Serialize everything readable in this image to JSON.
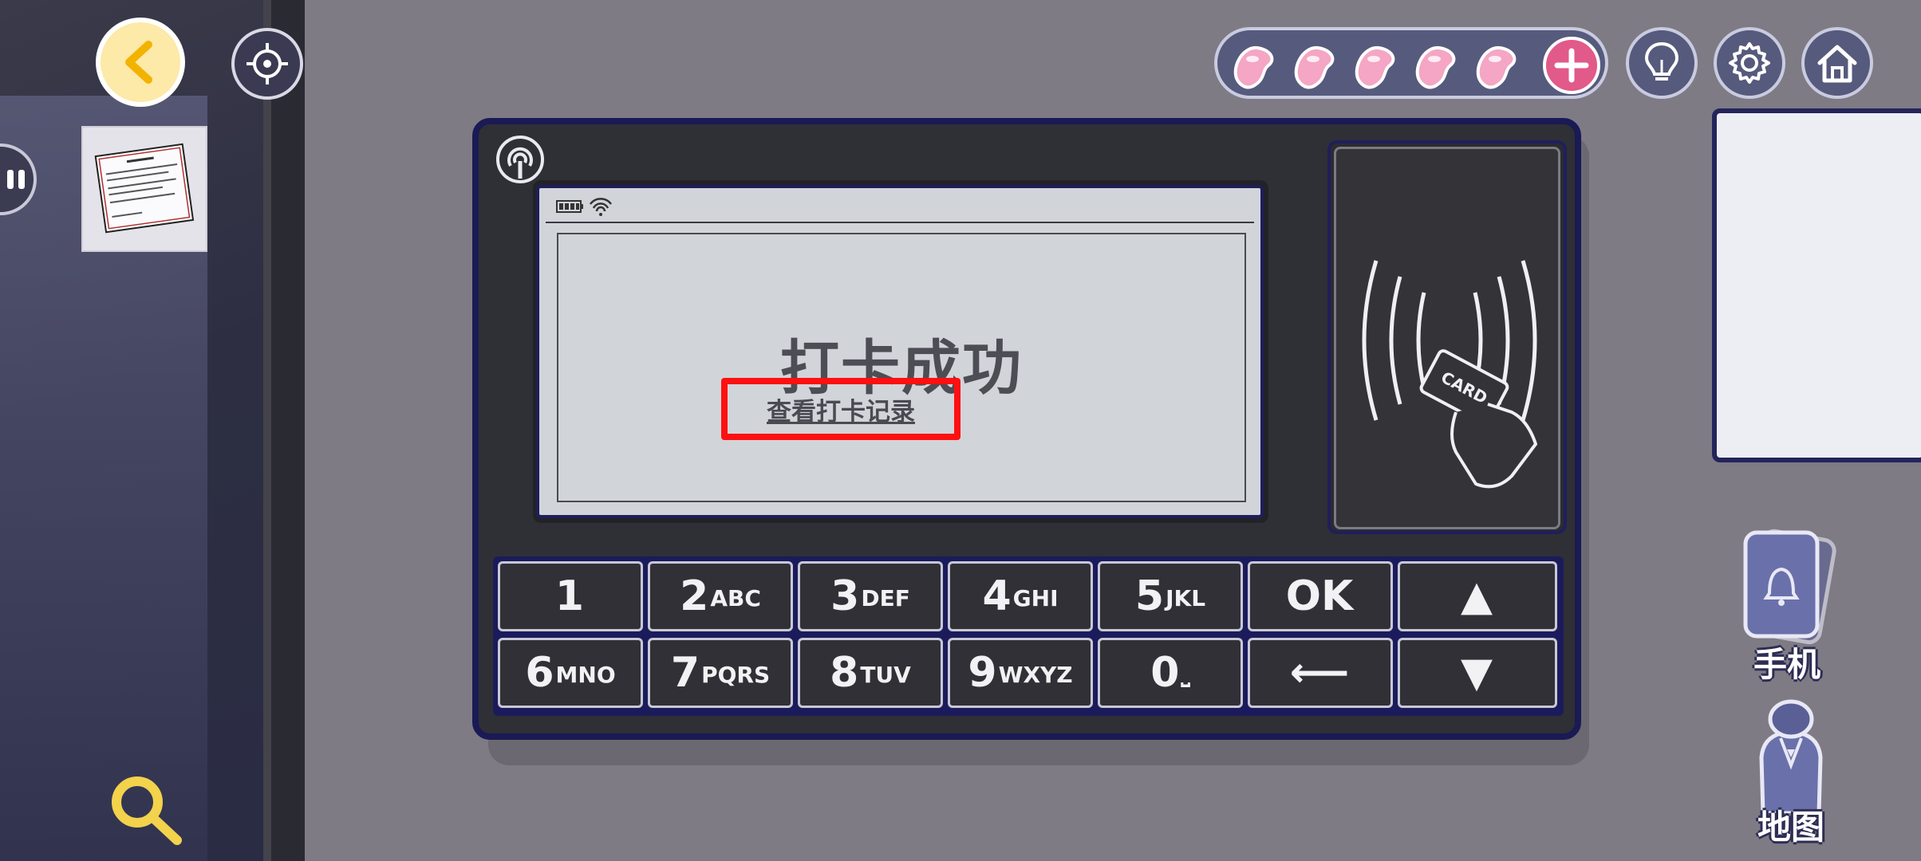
{
  "hud": {
    "energy_count": 5,
    "energy_icon": "pink-bean-icon",
    "add_icon": "plus-icon",
    "hint_icon": "lightbulb-icon",
    "settings_icon": "gear-icon",
    "home_icon": "home-icon",
    "back_icon": "chevron-left-icon",
    "locate_icon": "crosshair-icon",
    "search_icon": "magnifier-icon"
  },
  "screen": {
    "title": "打卡成功",
    "link": "查看打卡记录"
  },
  "reader": {
    "card_text": "CARD"
  },
  "keypad": {
    "row1": [
      {
        "digit": "1",
        "letters": ""
      },
      {
        "digit": "2",
        "letters": "ABC"
      },
      {
        "digit": "3",
        "letters": "DEF"
      },
      {
        "digit": "4",
        "letters": "GHI"
      },
      {
        "digit": "5",
        "letters": "JKL"
      },
      {
        "digit": "OK",
        "letters": ""
      },
      {
        "digit": "▲",
        "letters": ""
      }
    ],
    "row2": [
      {
        "digit": "6",
        "letters": "MNO"
      },
      {
        "digit": "7",
        "letters": "PQRS"
      },
      {
        "digit": "8",
        "letters": "TUV"
      },
      {
        "digit": "9",
        "letters": "WXYZ"
      },
      {
        "digit": "0",
        "letters": "⎵"
      },
      {
        "digit": "⟵",
        "letters": ""
      },
      {
        "digit": "▼",
        "letters": ""
      }
    ]
  },
  "side": {
    "phone_label": "手机",
    "map_label": "地图"
  },
  "colors": {
    "accent_pink": "#e15a8a",
    "highlight_red": "#ff1010",
    "hud_navy": "#565a7c"
  }
}
